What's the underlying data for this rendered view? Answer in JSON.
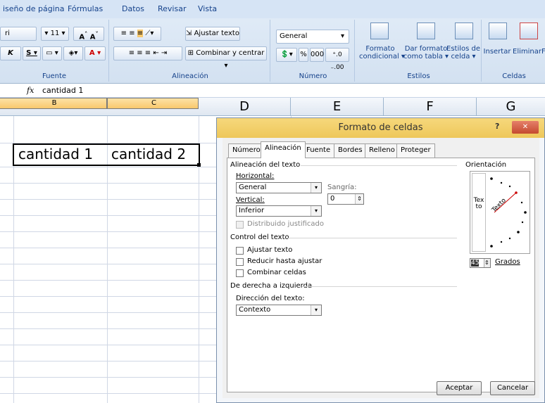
{
  "ribbon": {
    "tabs": [
      "iseño de página",
      "Fórmulas",
      "Datos",
      "Revisar",
      "Vista"
    ],
    "font_name": "ri",
    "font_size": "11",
    "wrap_text": "Ajustar texto",
    "merge_center": "Combinar y centrar",
    "number_format": "General",
    "percent": "%",
    "thousands": "000",
    "cond_format_1": "Formato",
    "cond_format_2": "condicional",
    "table_format_1": "Dar formato",
    "table_format_2": "como tabla",
    "cell_styles_1": "Estilos de",
    "cell_styles_2": "celda",
    "insert": "Insertar",
    "delete": "Eliminar",
    "delete_more": "F",
    "groups": {
      "font": "Fuente",
      "alignment": "Alineación",
      "number": "Número",
      "styles": "Estilos",
      "cells": "Celdas"
    }
  },
  "formula_bar": {
    "fx": "fx",
    "content": "cantidad 1"
  },
  "columns": [
    "B",
    "C",
    "D",
    "E",
    "F",
    "G"
  ],
  "cells": {
    "b2": "cantidad 1",
    "c2": "cantidad 2"
  },
  "dialog": {
    "title": "Formato de celdas",
    "help": "?",
    "close": "✕",
    "tabs": [
      "Número",
      "Alineación",
      "Fuente",
      "Bordes",
      "Relleno",
      "Proteger"
    ],
    "alignment_section": "Alineación del texto",
    "horizontal_label": "Horizontal:",
    "horizontal_value": "General",
    "indent_label": "Sangría:",
    "indent_value": "0",
    "vertical_label": "Vertical:",
    "vertical_value": "Inferior",
    "distributed": "Distribuido justificado",
    "control_section": "Control del texto",
    "wrap": "Ajustar texto",
    "shrink": "Reducir hasta ajustar",
    "merge": "Combinar celdas",
    "rtl_section": "De derecha a izquierda",
    "direction_label": "Dirección del texto:",
    "direction_value": "Contexto",
    "orientation_section": "Orientación",
    "vertical_text": "Texto",
    "rotated_text": "Texto",
    "degrees_value": "45",
    "degrees_label": "Grados",
    "accept": "Aceptar",
    "cancel": "Cancelar"
  }
}
